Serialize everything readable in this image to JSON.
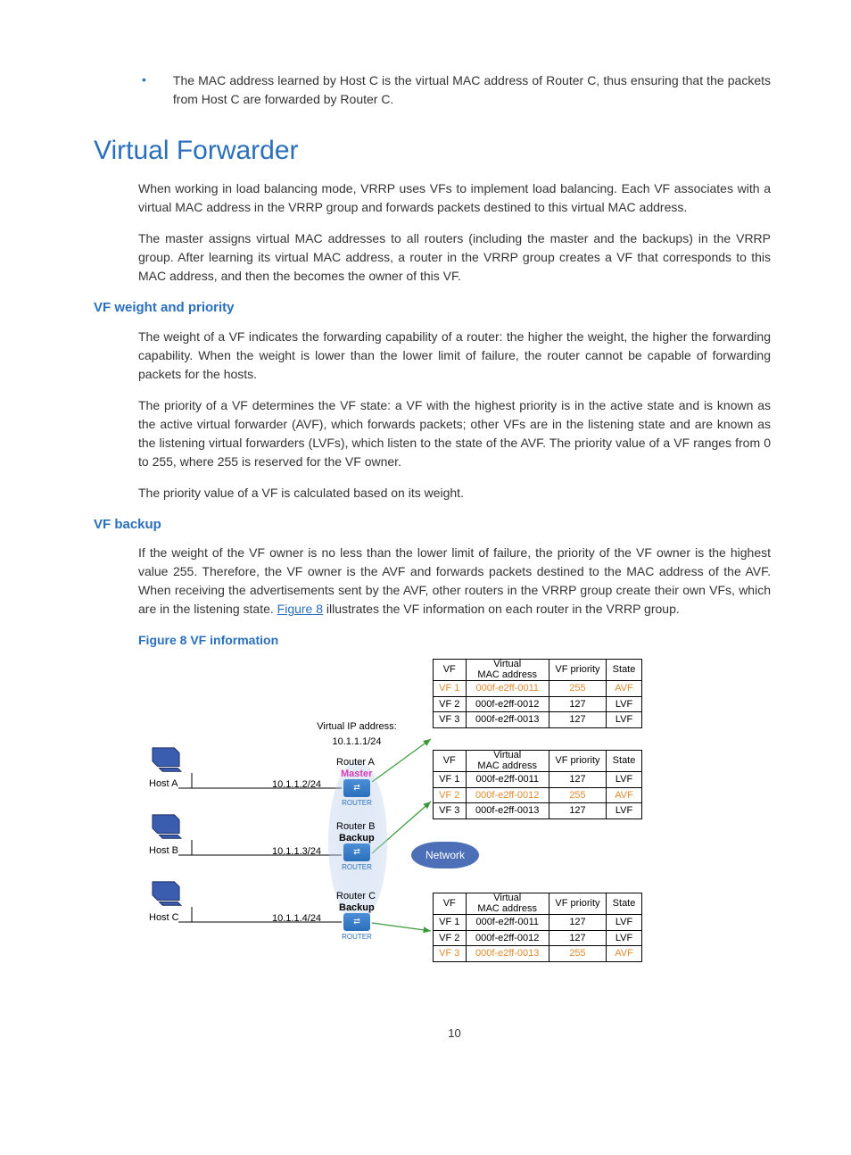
{
  "bullet": "The MAC address learned by Host C is the virtual MAC address of Router C, thus ensuring that the packets from Host C are forwarded by Router C.",
  "title": "Virtual Forwarder",
  "intro1": "When working in load balancing mode, VRRP uses VFs to implement load balancing. Each VF associates with a virtual MAC address in the VRRP group and forwards packets destined to this virtual MAC address.",
  "intro2": "The master assigns virtual MAC addresses to all routers (including the master and the backups) in the VRRP group. After learning its virtual MAC address, a router in the VRRP group creates a VF that corresponds to this MAC address, and then the becomes the owner of this VF.",
  "sub1": "VF weight and priority",
  "wp1": "The weight of a VF indicates the forwarding capability of a router: the higher the weight, the higher the forwarding capability. When the weight is lower than the lower limit of failure, the router cannot be capable of forwarding packets for the hosts.",
  "wp2": "The priority of a VF determines the VF state: a VF with the highest priority is in the active state and is known as the active virtual forwarder (AVF), which forwards packets; other VFs are in the listening state and are known as the listening virtual forwarders (LVFs), which listen to the state of the AVF. The priority value of a VF ranges from 0 to 255, where 255 is reserved for the VF owner.",
  "wp3": "The priority value of a VF is calculated based on its weight.",
  "sub2": "VF backup",
  "bk1a": "If the weight of the VF owner is no less than the lower limit of failure, the priority of the VF owner is the highest value 255. Therefore, the VF owner is the AVF and forwards packets destined to the MAC address of the AVF. When receiving the advertisements sent by the AVF, other routers in the VRRP group create their own VFs, which are in the listening state. ",
  "bk1link": "Figure 8",
  "bk1b": " illustrates the VF information on each router in the VRRP group.",
  "figcap": "Figure 8 VF information",
  "diagram": {
    "vip_label": "Virtual IP address:",
    "vip": "10.1.1.1/24",
    "routerA": "Router A",
    "roleA": "Master",
    "ipA": "10.1.1.2/24",
    "routerB": "Router B",
    "roleB": "Backup",
    "ipB": "10.1.1.3/24",
    "routerC": "Router C",
    "roleC": "Backup",
    "ipC": "10.1.1.4/24",
    "hostA": "Host A",
    "hostB": "Host B",
    "hostC": "Host C",
    "network": "Network",
    "headers": {
      "vf": "VF",
      "mac": "Virtual\nMAC address",
      "pri": "VF priority",
      "state": "State"
    },
    "tA": [
      {
        "vf": "VF 1",
        "mac": "000f-e2ff-0011",
        "pri": "255",
        "state": "AVF",
        "hl": true
      },
      {
        "vf": "VF 2",
        "mac": "000f-e2ff-0012",
        "pri": "127",
        "state": "LVF",
        "hl": false
      },
      {
        "vf": "VF 3",
        "mac": "000f-e2ff-0013",
        "pri": "127",
        "state": "LVF",
        "hl": false
      }
    ],
    "tB": [
      {
        "vf": "VF 1",
        "mac": "000f-e2ff-0011",
        "pri": "127",
        "state": "LVF",
        "hl": false
      },
      {
        "vf": "VF 2",
        "mac": "000f-e2ff-0012",
        "pri": "255",
        "state": "AVF",
        "hl": true
      },
      {
        "vf": "VF 3",
        "mac": "000f-e2ff-0013",
        "pri": "127",
        "state": "LVF",
        "hl": false
      }
    ],
    "tC": [
      {
        "vf": "VF 1",
        "mac": "000f-e2ff-0011",
        "pri": "127",
        "state": "LVF",
        "hl": false
      },
      {
        "vf": "VF 2",
        "mac": "000f-e2ff-0012",
        "pri": "127",
        "state": "LVF",
        "hl": false
      },
      {
        "vf": "VF 3",
        "mac": "000f-e2ff-0013",
        "pri": "255",
        "state": "AVF",
        "hl": true
      }
    ]
  },
  "pageNumber": "10"
}
